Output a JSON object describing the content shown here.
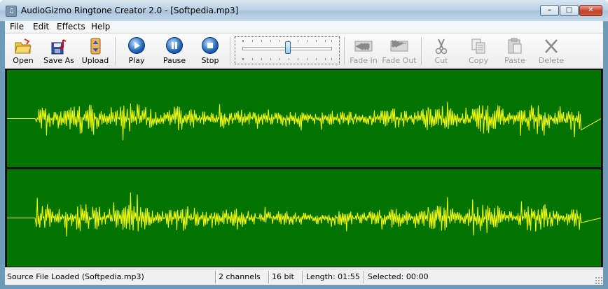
{
  "window": {
    "title": "AudioGizmo Ringtone Creator 2.0 - [Softpedia.mp3]",
    "icon": "music-note-icon"
  },
  "menu": {
    "items": [
      "File",
      "Edit",
      "Effects",
      "Help"
    ]
  },
  "toolbar": {
    "open": "Open",
    "save_as": "Save As",
    "upload": "Upload",
    "play": "Play",
    "pause": "Pause",
    "stop": "Stop",
    "fade_in": "Fade In",
    "fade_out": "Fade Out",
    "cut": "Cut",
    "copy": "Copy",
    "paste": "Paste",
    "delete": "Delete"
  },
  "volume_slider": {
    "value": 0.5
  },
  "waveform": {
    "channels": 2,
    "background": "#007300",
    "wave_color": "#ffff00"
  },
  "status": {
    "message": "Source File Loaded (Softpedia.mp3)",
    "channels": "2 channels",
    "bits": "16 bit",
    "length": "Length: 01:55",
    "selected": "Selected: 00:00"
  },
  "colors": {
    "waveform_bg": "#007300",
    "waveform_line": "#ffff00"
  }
}
